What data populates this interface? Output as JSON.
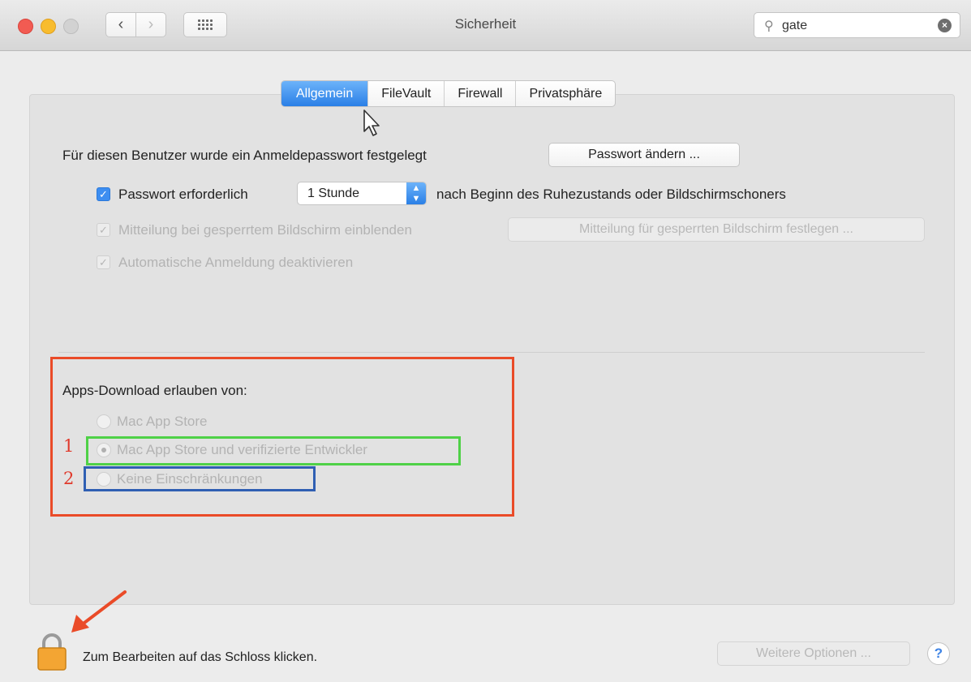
{
  "window": {
    "title": "Sicherheit"
  },
  "search": {
    "value": "gate"
  },
  "tabs": [
    {
      "label": "Allgemein",
      "active": true
    },
    {
      "label": "FileVault",
      "active": false
    },
    {
      "label": "Firewall",
      "active": false
    },
    {
      "label": "Privatsphäre",
      "active": false
    }
  ],
  "general": {
    "password_text": "Für diesen Benutzer wurde ein Anmeldepasswort festgelegt",
    "change_password_button": "Passwort ändern ...",
    "require_password_label": "Passwort erforderlich",
    "require_password_checked": true,
    "require_password_delay": "1 Stunde",
    "require_password_suffix": "nach Beginn des Ruhezustands oder Bildschirmschoners",
    "lock_message_label": "Mitteilung bei gesperrtem Bildschirm einblenden",
    "lock_message_button": "Mitteilung für gesperrten Bildschirm festlegen ...",
    "auto_login_label": "Automatische Anmeldung deaktivieren"
  },
  "apps_download": {
    "heading": "Apps-Download erlauben von:",
    "options": [
      {
        "label": "Mac App Store",
        "selected": false
      },
      {
        "label": "Mac App Store und verifizierte Entwickler",
        "selected": true
      },
      {
        "label": "Keine Einschränkungen",
        "selected": false
      }
    ]
  },
  "annotations": {
    "number_1": "1",
    "number_2": "2"
  },
  "footer": {
    "lock_text": "Zum Bearbeiten auf das Schloss klicken.",
    "more_options_button": "Weitere Optionen ...",
    "help_label": "?"
  },
  "colors": {
    "accent_blue": "#2a7fe6",
    "annotation_red": "#ea4b28",
    "annotation_green": "#4fd147",
    "annotation_blue": "#2f5fb3",
    "lock_orange": "#f3a533"
  }
}
